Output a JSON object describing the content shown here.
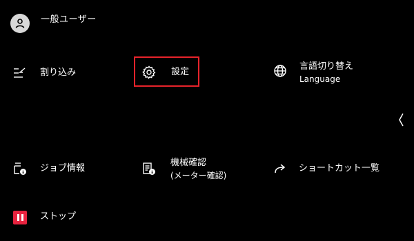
{
  "user": {
    "name": "一般ユーザー",
    "icon": "person-icon"
  },
  "menu": {
    "interrupt": {
      "label": "割り込み",
      "icon": "interrupt-icon"
    },
    "settings": {
      "label": "設定",
      "icon": "gear-icon"
    },
    "language": {
      "label": "言語切り替え",
      "sublabel": "Language",
      "icon": "globe-icon"
    },
    "job_info": {
      "label": "ジョブ情報",
      "icon": "job-info-icon"
    },
    "machine_check": {
      "label": "機械確認",
      "sublabel": "(メーター確認)",
      "icon": "machine-check-icon"
    },
    "shortcuts": {
      "label": "ショートカット一覧",
      "icon": "shortcut-arrow-icon"
    },
    "stop": {
      "label": "ストップ",
      "icon": "stop-icon"
    }
  },
  "colors": {
    "highlight": "#e8232b",
    "stop": "#e8233f",
    "background": "#000000"
  }
}
